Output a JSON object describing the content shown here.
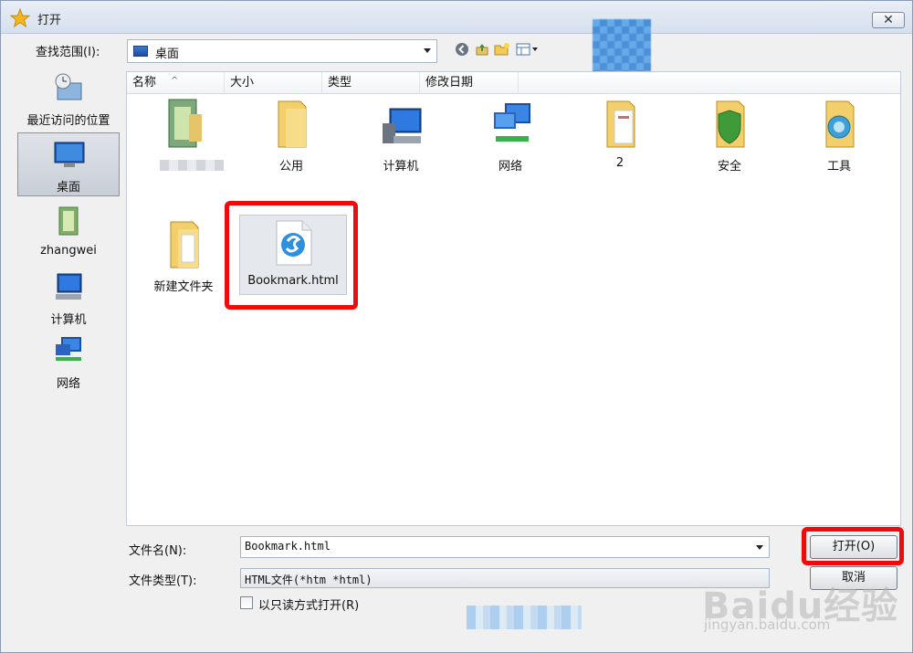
{
  "window": {
    "title": "打开",
    "close_symbol": "✕"
  },
  "lookin": {
    "label": "查找范围(I):",
    "value": "桌面"
  },
  "toolbar_icons": [
    "back-icon",
    "up-folder-icon",
    "new-folder-icon",
    "view-menu-icon"
  ],
  "places": [
    {
      "label": "最近访问的位置",
      "icon": "recent-places-icon"
    },
    {
      "label": "桌面",
      "icon": "desktop-icon",
      "selected": true
    },
    {
      "label": "zhangwei",
      "icon": "user-folder-icon"
    },
    {
      "label": "计算机",
      "icon": "computer-icon"
    },
    {
      "label": "网络",
      "icon": "network-icon"
    }
  ],
  "columns": [
    "名称",
    "大小",
    "类型",
    "修改日期"
  ],
  "files": [
    {
      "name": "",
      "icon": "library-folder-icon"
    },
    {
      "name": "公用",
      "icon": "folder-icon"
    },
    {
      "name": "计算机",
      "icon": "computer-icon"
    },
    {
      "name": "网络",
      "icon": "network-icon"
    },
    {
      "name": "2",
      "icon": "folder-icon"
    },
    {
      "name": "安全",
      "icon": "folder-icon"
    },
    {
      "name": "工具",
      "icon": "folder-icon"
    },
    {
      "name": "新建文件夹",
      "icon": "folder-icon"
    },
    {
      "name": "Bookmark.html",
      "icon": "html-file-icon",
      "selected": true
    }
  ],
  "filename": {
    "label": "文件名(N):",
    "value": "Bookmark.html"
  },
  "filetype": {
    "label": "文件类型(T):",
    "value": "HTML文件(*htm *html)"
  },
  "buttons": {
    "open": "打开(O)",
    "cancel": "取消"
  },
  "readonly": {
    "label": "以只读方式打开(R)",
    "checked": false
  },
  "watermark": {
    "logo": "Baidu经验",
    "url": "jingyan.baidu.com"
  },
  "colors": {
    "highlight": "#ef0b0b",
    "folder": "#f2cf6b"
  }
}
